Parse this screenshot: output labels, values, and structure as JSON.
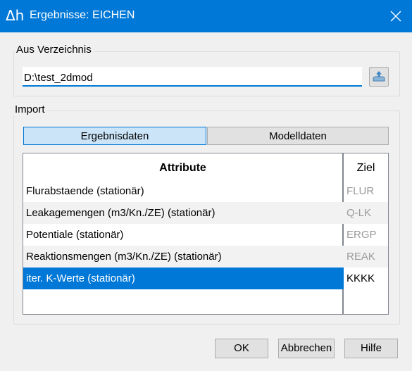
{
  "window": {
    "icon_text": "Δh",
    "title": "Ergebnisse: EICHEN"
  },
  "source_group": {
    "label": "Aus Verzeichnis",
    "path_value": "D:\\test_2dmod"
  },
  "import_group": {
    "label": "Import",
    "tabs": [
      {
        "label": "Ergebnisdaten",
        "active": true
      },
      {
        "label": "Modelldaten",
        "active": false
      }
    ],
    "table": {
      "headers": {
        "attribute": "Attribute",
        "target": "Ziel"
      },
      "rows": [
        {
          "attribute": "Flurabstaende (stationär)",
          "target": "FLUR"
        },
        {
          "attribute": "Leakagemengen (m3/Kn./ZE) (stationär)",
          "target": "Q-LK"
        },
        {
          "attribute": "Potentiale (stationär)",
          "target": "ERGP"
        },
        {
          "attribute": "Reaktionsmengen (m3/Kn./ZE) (stationär)",
          "target": "REAK"
        },
        {
          "attribute": "iter. K-Werte (stationär)",
          "target": "KKKK",
          "selected": true
        }
      ]
    }
  },
  "buttons": {
    "ok": "OK",
    "cancel": "Abbrechen",
    "help": "Hilfe"
  },
  "colors": {
    "accent": "#0078d7",
    "selection": "#0078d7",
    "tab_active": "#cce4f7"
  }
}
